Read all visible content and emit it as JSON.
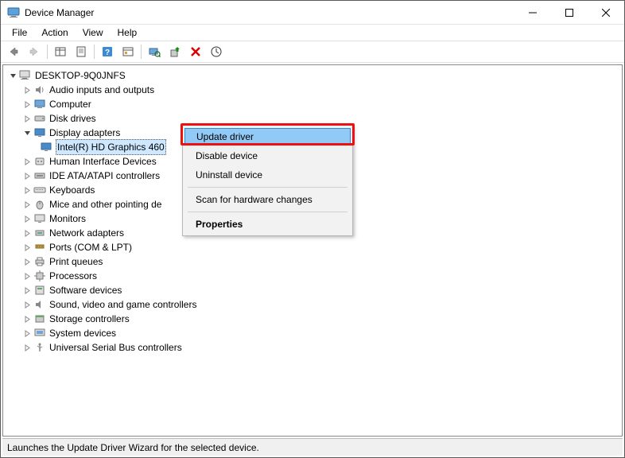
{
  "window": {
    "title": "Device Manager"
  },
  "menubar": {
    "items": [
      "File",
      "Action",
      "View",
      "Help"
    ]
  },
  "toolbar": {
    "buttons": [
      "back",
      "forward",
      "show-hidden",
      "properties",
      "help",
      "options",
      "scan-hardware",
      "update-driver",
      "uninstall",
      "enable"
    ]
  },
  "tree": {
    "root": {
      "label": "DESKTOP-9Q0JNFS",
      "expanded": true
    },
    "categories": [
      {
        "label": "Audio inputs and outputs",
        "icon": "audio",
        "expanded": false
      },
      {
        "label": "Computer",
        "icon": "computer",
        "expanded": false
      },
      {
        "label": "Disk drives",
        "icon": "disk",
        "expanded": false
      },
      {
        "label": "Display adapters",
        "icon": "display",
        "expanded": true,
        "children": [
          {
            "label": "Intel(R) HD Graphics 460",
            "icon": "display",
            "selected": true
          }
        ]
      },
      {
        "label": "Human Interface Devices",
        "icon": "hid",
        "expanded": false
      },
      {
        "label": "IDE ATA/ATAPI controllers",
        "icon": "ide",
        "expanded": false
      },
      {
        "label": "Keyboards",
        "icon": "keyboard",
        "expanded": false
      },
      {
        "label": "Mice and other pointing devices",
        "icon": "mouse",
        "expanded": false,
        "truncated": "Mice and other pointing de"
      },
      {
        "label": "Monitors",
        "icon": "monitor",
        "expanded": false
      },
      {
        "label": "Network adapters",
        "icon": "network",
        "expanded": false
      },
      {
        "label": "Ports (COM & LPT)",
        "icon": "port",
        "expanded": false
      },
      {
        "label": "Print queues",
        "icon": "printer",
        "expanded": false
      },
      {
        "label": "Processors",
        "icon": "cpu",
        "expanded": false
      },
      {
        "label": "Software devices",
        "icon": "software",
        "expanded": false
      },
      {
        "label": "Sound, video and game controllers",
        "icon": "sound",
        "expanded": false
      },
      {
        "label": "Storage controllers",
        "icon": "storage",
        "expanded": false
      },
      {
        "label": "System devices",
        "icon": "system",
        "expanded": false
      },
      {
        "label": "Universal Serial Bus controllers",
        "icon": "usb",
        "expanded": false
      }
    ]
  },
  "context_menu": {
    "items": [
      {
        "label": "Update driver",
        "highlighted": true
      },
      {
        "label": "Disable device"
      },
      {
        "label": "Uninstall device"
      },
      {
        "separator": true
      },
      {
        "label": "Scan for hardware changes"
      },
      {
        "separator": true
      },
      {
        "label": "Properties",
        "bold": true
      }
    ]
  },
  "statusbar": {
    "text": "Launches the Update Driver Wizard for the selected device."
  },
  "icons": {
    "computer_svg": "computer-icon"
  }
}
